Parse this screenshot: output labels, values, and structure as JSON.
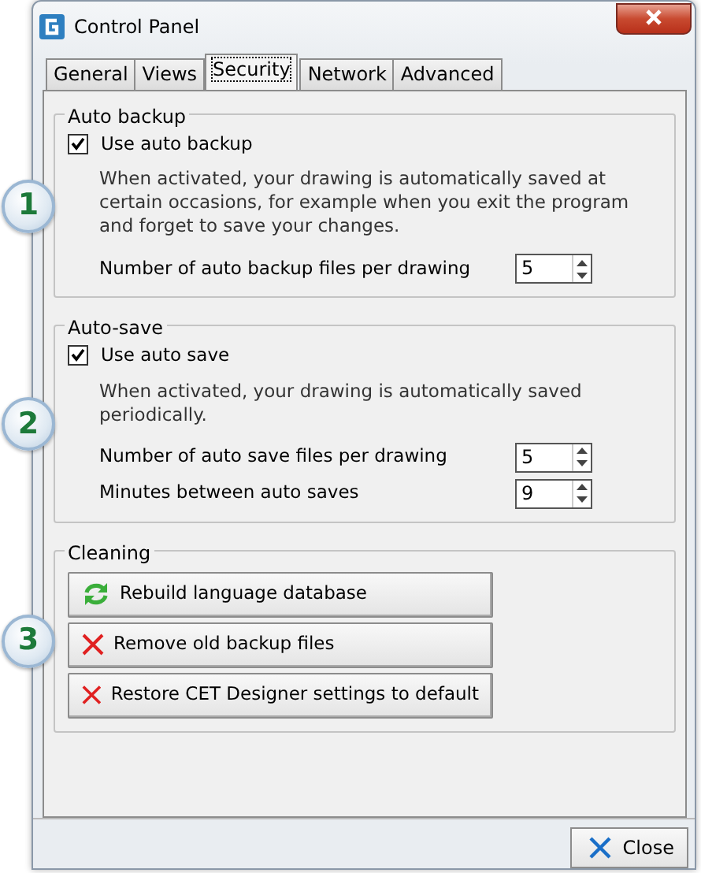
{
  "window": {
    "title": "Control Panel"
  },
  "tabs": [
    {
      "label": "General",
      "selected": false
    },
    {
      "label": "Views",
      "selected": false
    },
    {
      "label": "Security",
      "selected": true
    },
    {
      "label": "Network",
      "selected": false
    },
    {
      "label": "Advanced",
      "selected": false
    }
  ],
  "groups": [
    {
      "title": "Auto backup",
      "callout": "1",
      "checkbox": {
        "label": "Use auto backup",
        "checked": true
      },
      "description": "When activated, your drawing is automatically saved at certain occasions, for example when you exit the program and forget to save your changes.",
      "fields": [
        {
          "label": "Number of auto backup files per drawing",
          "value": "5"
        }
      ]
    },
    {
      "title": "Auto-save",
      "callout": "2",
      "checkbox": {
        "label": "Use auto save",
        "checked": true
      },
      "description": "When activated, your drawing is automatically saved periodically.",
      "fields": [
        {
          "label": "Number of auto save files per drawing",
          "value": "5"
        },
        {
          "label": "Minutes between auto saves",
          "value": "9"
        }
      ]
    },
    {
      "title": "Cleaning",
      "callout": "3",
      "buttons": [
        {
          "label": "Rebuild language database",
          "kind": "refresh"
        },
        {
          "label": "Remove old backup files",
          "kind": "remove"
        },
        {
          "label": "Restore CET Designer settings to default",
          "kind": "remove"
        }
      ]
    }
  ],
  "footer": {
    "button": "Close"
  }
}
